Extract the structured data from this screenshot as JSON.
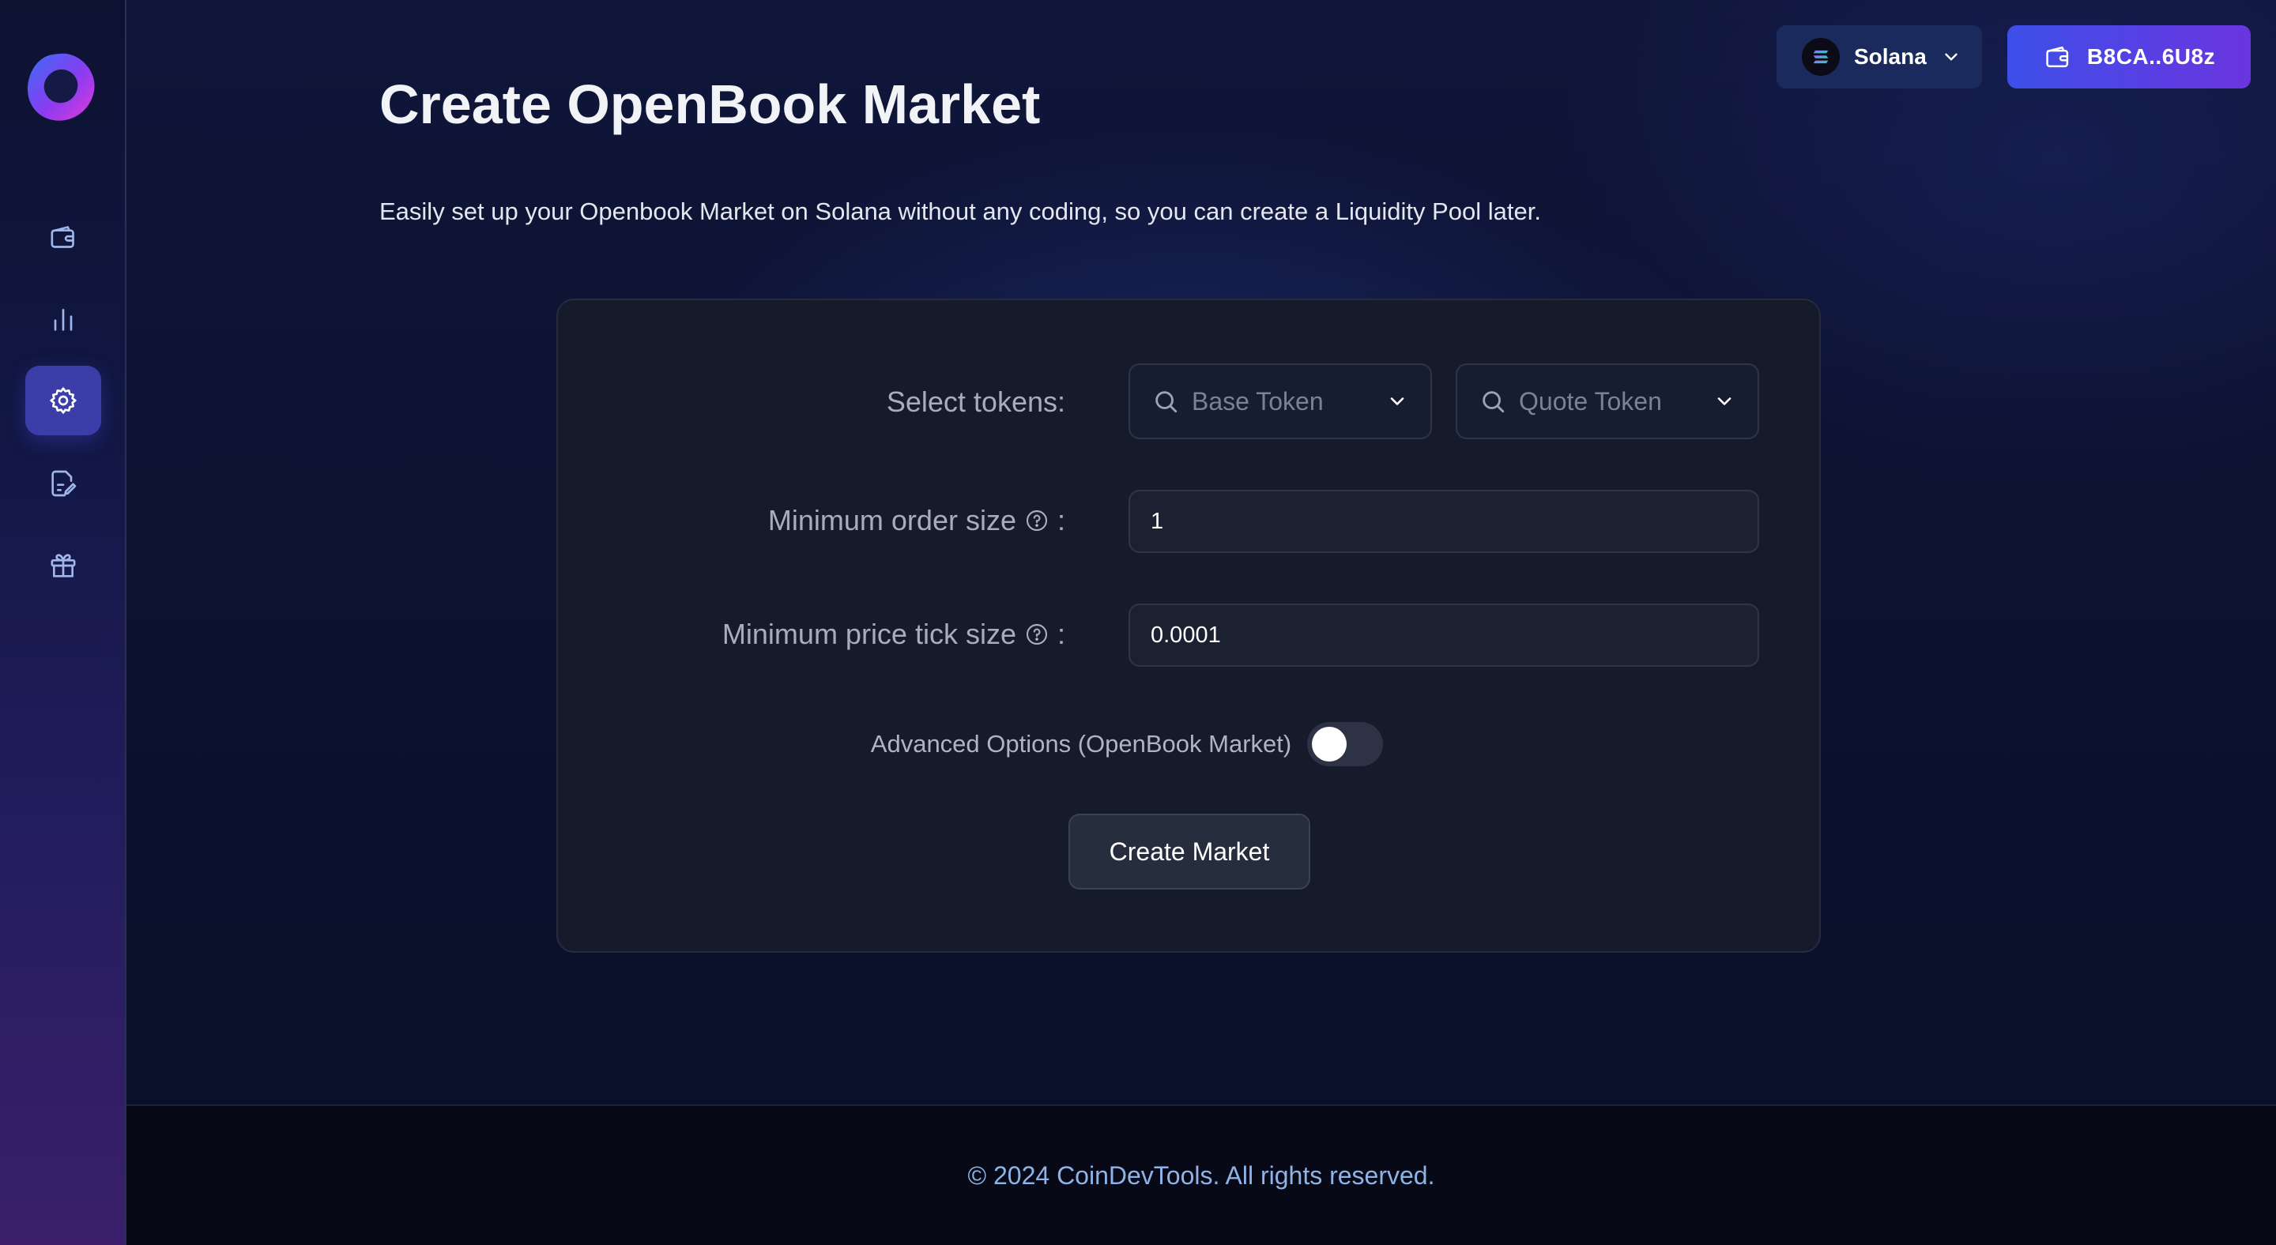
{
  "sidebar": {
    "items": [
      {
        "icon": "wallet-icon",
        "active": false
      },
      {
        "icon": "chart-icon",
        "active": false
      },
      {
        "icon": "gear-icon",
        "active": true
      },
      {
        "icon": "edit-document-icon",
        "active": false
      },
      {
        "icon": "gift-icon",
        "active": false
      }
    ]
  },
  "header": {
    "network_label": "Solana",
    "wallet_label": "B8CA..6U8z"
  },
  "page": {
    "title": "Create OpenBook Market",
    "subtitle": "Easily set up your Openbook Market on Solana without any coding, so you can create a Liquidity Pool later."
  },
  "form": {
    "select_tokens_label": "Select tokens:",
    "base_token_placeholder": "Base Token",
    "quote_token_placeholder": "Quote Token",
    "min_order_label": "Minimum order size",
    "min_order_value": "1",
    "min_tick_label": "Minimum price tick size",
    "min_tick_value": "0.0001",
    "colon": ":",
    "advanced_label": "Advanced Options (OpenBook Market)",
    "advanced_enabled": false,
    "submit_label": "Create Market"
  },
  "footer": {
    "text": "© 2024 CoinDevTools. All rights reserved."
  },
  "colors": {
    "accent": "#3d4fe8",
    "accent_end": "#6a35e0",
    "sidebar_active": "#3b3ea8",
    "card_bg": "#151b2b"
  }
}
